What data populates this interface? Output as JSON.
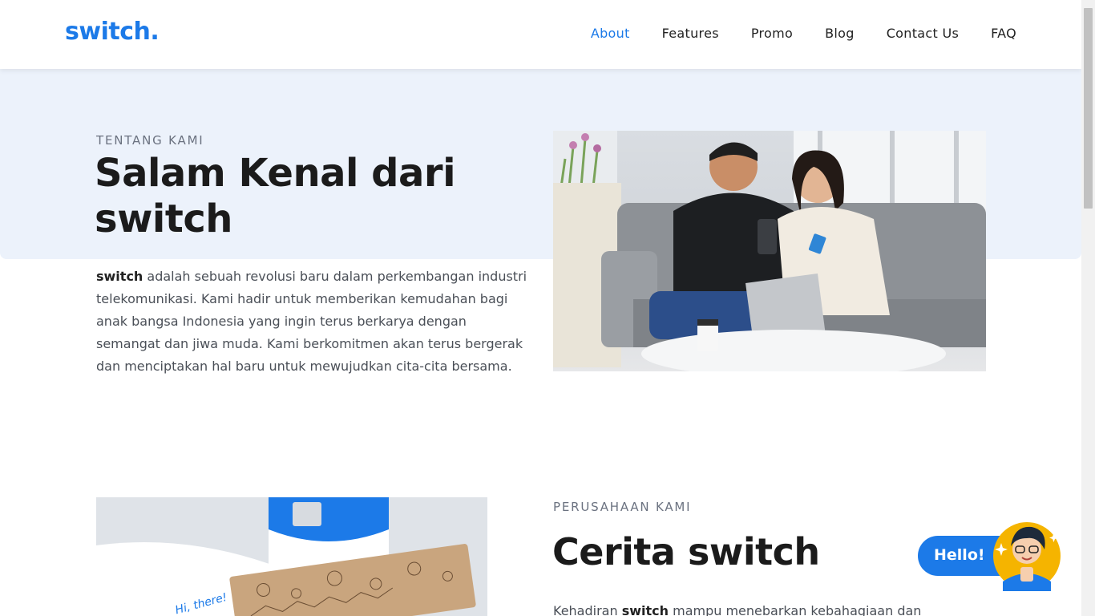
{
  "header": {
    "logo": "switch.",
    "nav": [
      {
        "label": "About",
        "active": true
      },
      {
        "label": "Features",
        "active": false
      },
      {
        "label": "Promo",
        "active": false
      },
      {
        "label": "Blog",
        "active": false
      },
      {
        "label": "Contact Us",
        "active": false
      },
      {
        "label": "FAQ",
        "active": false
      }
    ]
  },
  "about": {
    "eyebrow": "TENTANG KAMI",
    "title_line1": "Salam Kenal dari",
    "title_line2": "switch",
    "body_bold": "switch",
    "body_rest": " adalah sebuah revolusi baru dalam perkembangan industri telekomunikasi. Kami hadir untuk memberikan kemudahan bagi anak bangsa Indonesia yang ingin terus berkarya dengan semangat dan jiwa muda. Kami berkomitmen akan terus bergerak dan menciptakan hal baru untuk mewujudkan cita-cita bersama."
  },
  "story": {
    "eyebrow": "PERUSAHAAN KAMI",
    "title": "Cerita switch",
    "body_prefix": "Kehadiran ",
    "body_bold": "switch",
    "body_rest": " mampu menebarkan kebahagiaan dan",
    "package_text": "Hi, there!"
  },
  "chat": {
    "label": "Hello!"
  },
  "colors": {
    "brand": "#1c7ae8",
    "hero_band": "#ecf2fb"
  }
}
